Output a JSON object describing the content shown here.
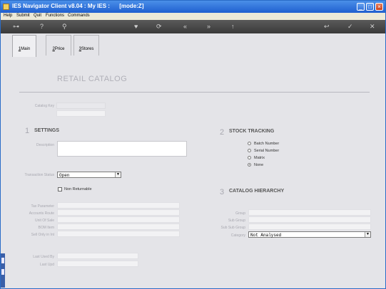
{
  "window": {
    "title": "IES Navigator Client v8.04 : My IES :      [mode:Z]"
  },
  "menu": [
    "Help",
    "Submit",
    "Quit",
    "Functions",
    "Commands"
  ],
  "toolbar": {
    "icons": [
      "key-icon",
      "help-icon",
      "search-icon",
      "heart-icon",
      "refresh-icon",
      "first-icon",
      "last-icon",
      "up-icon",
      "back-icon",
      "ok-icon",
      "close-icon"
    ],
    "glyphs": [
      "⊶",
      "?",
      "⚲",
      "♥",
      "⟳",
      "«",
      "»",
      "↑",
      "↩",
      "✓",
      "✕"
    ]
  },
  "tabs": [
    {
      "num": "1",
      "label": "Main"
    },
    {
      "num": "2",
      "label": "Price"
    },
    {
      "num": "3",
      "label": "Stores"
    }
  ],
  "heading": "RETAIL CATALOG",
  "catalog_key": {
    "label": "Catalog Key",
    "value": ""
  },
  "settings": {
    "num": "1",
    "title": "SETTINGS",
    "description_label": "Description",
    "transaction_status_label": "Transaction Status",
    "transaction_status_value": "Open",
    "non_returnable_label": "Non Returnable",
    "tax_parameter_label": "Tax Parameter",
    "accounts_route_label": "Accounts Route",
    "unit_of_sale_label": "Unit Of Sale",
    "bom_item_label": "BOM Item",
    "sell_only_label": "Sell Only in Int"
  },
  "stock_tracking": {
    "num": "2",
    "title": "STOCK TRACKING",
    "options": [
      "Batch Number",
      "Serial Number",
      "Matrix",
      "None"
    ],
    "selected": "None"
  },
  "catalog_hierarchy": {
    "num": "3",
    "title": "CATALOG HIERARCHY",
    "group_label": "Group",
    "sub_group_label": "Sub Group",
    "sub_sub_group_label": "Sub Sub Group",
    "category_label": "Category",
    "category_value": "Not Analysed"
  },
  "last_used_by_label": "Last Used By",
  "last_upd_label": "Last Upd"
}
